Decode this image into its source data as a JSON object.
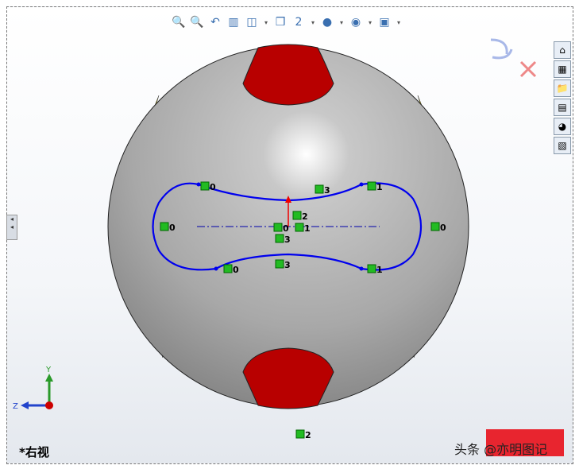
{
  "toolbar": {
    "items": [
      {
        "name": "zoom-to-fit-icon",
        "glyph": "🔍"
      },
      {
        "name": "zoom-to-area-icon",
        "glyph": "🔍"
      },
      {
        "name": "previous-view-icon",
        "glyph": "↶"
      },
      {
        "name": "section-view-icon",
        "glyph": "▥"
      },
      {
        "name": "view-orientation-icon",
        "glyph": "◫",
        "dropdown": true
      },
      {
        "name": "display-style-icon",
        "glyph": "❒"
      },
      {
        "name": "view-relations-icon",
        "glyph": "2",
        "dropdown": true
      },
      {
        "name": "appearance-icon",
        "glyph": "●",
        "dropdown": true
      },
      {
        "name": "scene-icon",
        "glyph": "◉",
        "dropdown": true
      },
      {
        "name": "view-settings-icon",
        "glyph": "▣",
        "dropdown": true
      }
    ]
  },
  "right_panel": [
    "home-icon",
    "design-library-icon",
    "file-explorer-icon",
    "view-palette-icon",
    "appearances-icon",
    "custom-properties-icon"
  ],
  "relations": {
    "r0": "0",
    "r1": "1",
    "r2": "2",
    "r3": "3"
  },
  "triad": {
    "y": "Y",
    "z": "Z"
  },
  "view_label": "*右视",
  "watermark": "头条 @亦明图记",
  "seal_text": "亦明图记",
  "colors": {
    "sketch": "#0000ee",
    "relation": "#22bb22",
    "patch": "#c00000",
    "accent": "#c8b400"
  }
}
